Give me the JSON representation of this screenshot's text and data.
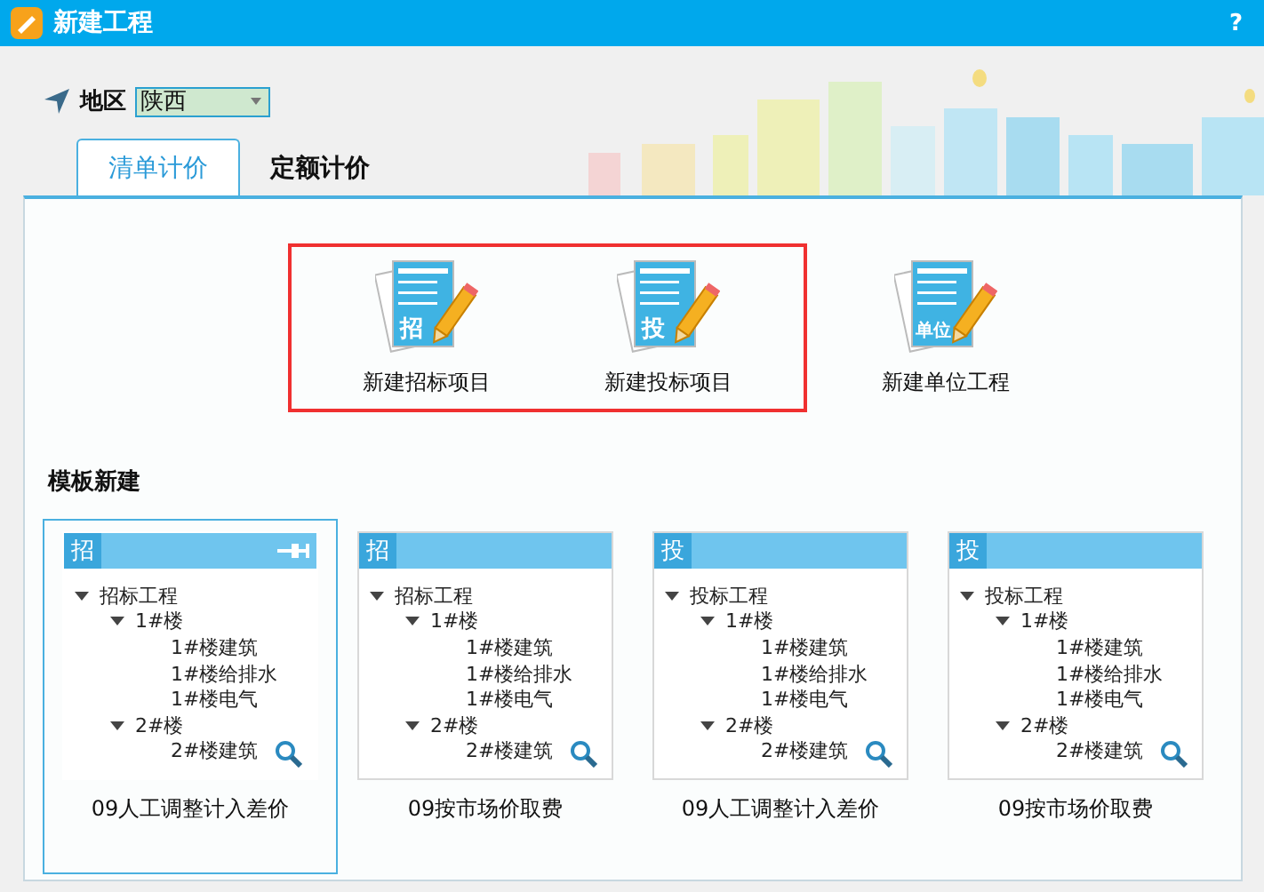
{
  "window": {
    "title": "新建工程",
    "help": "?"
  },
  "region": {
    "label": "地区",
    "value": "陕西"
  },
  "tabs": [
    {
      "label": "清单计价",
      "selected": true
    },
    {
      "label": "定额计价",
      "selected": false
    }
  ],
  "action_groups": [
    {
      "highlighted": true,
      "items": [
        {
          "badge": "招",
          "label": "新建招标项目"
        },
        {
          "badge": "投",
          "label": "新建投标项目"
        }
      ]
    },
    {
      "highlighted": false,
      "items": [
        {
          "badge": "单位",
          "label": "新建单位工程"
        }
      ]
    }
  ],
  "templates_heading": "模板新建",
  "templates": [
    {
      "badge": "招",
      "selected": true,
      "caption": "09人工调整计入差价",
      "tree": [
        {
          "label": "招标工程",
          "expanded": true,
          "children": [
            {
              "label": "1#楼",
              "expanded": true,
              "children": [
                {
                  "label": "1#楼建筑"
                },
                {
                  "label": "1#楼给排水"
                },
                {
                  "label": "1#楼电气"
                }
              ]
            },
            {
              "label": "2#楼",
              "expanded": true,
              "children": [
                {
                  "label": "2#楼建筑"
                }
              ]
            }
          ]
        }
      ]
    },
    {
      "badge": "招",
      "selected": false,
      "caption": "09按市场价取费",
      "tree": [
        {
          "label": "招标工程",
          "expanded": true,
          "children": [
            {
              "label": "1#楼",
              "expanded": true,
              "children": [
                {
                  "label": "1#楼建筑"
                },
                {
                  "label": "1#楼给排水"
                },
                {
                  "label": "1#楼电气"
                }
              ]
            },
            {
              "label": "2#楼",
              "expanded": true,
              "children": [
                {
                  "label": "2#楼建筑"
                }
              ]
            }
          ]
        }
      ]
    },
    {
      "badge": "投",
      "selected": false,
      "caption": "09人工调整计入差价",
      "tree": [
        {
          "label": "投标工程",
          "expanded": true,
          "children": [
            {
              "label": "1#楼",
              "expanded": true,
              "children": [
                {
                  "label": "1#楼建筑"
                },
                {
                  "label": "1#楼给排水"
                },
                {
                  "label": "1#楼电气"
                }
              ]
            },
            {
              "label": "2#楼",
              "expanded": true,
              "children": [
                {
                  "label": "2#楼建筑"
                }
              ]
            }
          ]
        }
      ]
    },
    {
      "badge": "投",
      "selected": false,
      "caption": "09按市场价取费",
      "tree": [
        {
          "label": "投标工程",
          "expanded": true,
          "children": [
            {
              "label": "1#楼",
              "expanded": true,
              "children": [
                {
                  "label": "1#楼建筑"
                },
                {
                  "label": "1#楼给排水"
                },
                {
                  "label": "1#楼电气"
                }
              ]
            },
            {
              "label": "2#楼",
              "expanded": true,
              "children": [
                {
                  "label": "2#楼建筑"
                }
              ]
            }
          ]
        }
      ]
    }
  ]
}
